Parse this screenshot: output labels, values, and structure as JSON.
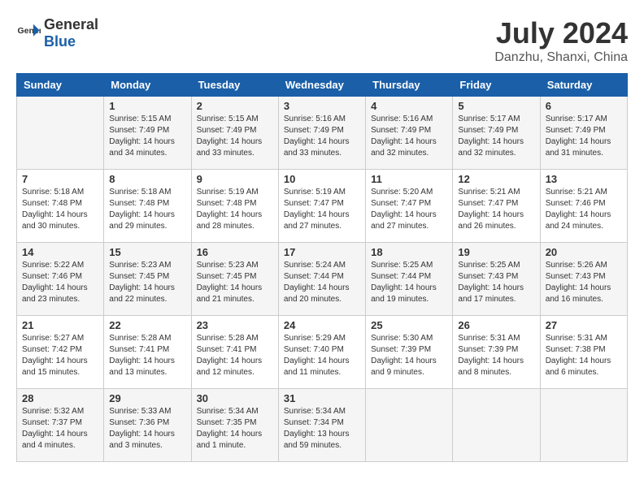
{
  "logo": {
    "general": "General",
    "blue": "Blue"
  },
  "title": {
    "month": "July 2024",
    "location": "Danzhu, Shanxi, China"
  },
  "days_of_week": [
    "Sunday",
    "Monday",
    "Tuesday",
    "Wednesday",
    "Thursday",
    "Friday",
    "Saturday"
  ],
  "weeks": [
    [
      {
        "day": "",
        "info": ""
      },
      {
        "day": "1",
        "info": "Sunrise: 5:15 AM\nSunset: 7:49 PM\nDaylight: 14 hours\nand 34 minutes."
      },
      {
        "day": "2",
        "info": "Sunrise: 5:15 AM\nSunset: 7:49 PM\nDaylight: 14 hours\nand 33 minutes."
      },
      {
        "day": "3",
        "info": "Sunrise: 5:16 AM\nSunset: 7:49 PM\nDaylight: 14 hours\nand 33 minutes."
      },
      {
        "day": "4",
        "info": "Sunrise: 5:16 AM\nSunset: 7:49 PM\nDaylight: 14 hours\nand 32 minutes."
      },
      {
        "day": "5",
        "info": "Sunrise: 5:17 AM\nSunset: 7:49 PM\nDaylight: 14 hours\nand 32 minutes."
      },
      {
        "day": "6",
        "info": "Sunrise: 5:17 AM\nSunset: 7:49 PM\nDaylight: 14 hours\nand 31 minutes."
      }
    ],
    [
      {
        "day": "7",
        "info": "Sunrise: 5:18 AM\nSunset: 7:48 PM\nDaylight: 14 hours\nand 30 minutes."
      },
      {
        "day": "8",
        "info": "Sunrise: 5:18 AM\nSunset: 7:48 PM\nDaylight: 14 hours\nand 29 minutes."
      },
      {
        "day": "9",
        "info": "Sunrise: 5:19 AM\nSunset: 7:48 PM\nDaylight: 14 hours\nand 28 minutes."
      },
      {
        "day": "10",
        "info": "Sunrise: 5:19 AM\nSunset: 7:47 PM\nDaylight: 14 hours\nand 27 minutes."
      },
      {
        "day": "11",
        "info": "Sunrise: 5:20 AM\nSunset: 7:47 PM\nDaylight: 14 hours\nand 27 minutes."
      },
      {
        "day": "12",
        "info": "Sunrise: 5:21 AM\nSunset: 7:47 PM\nDaylight: 14 hours\nand 26 minutes."
      },
      {
        "day": "13",
        "info": "Sunrise: 5:21 AM\nSunset: 7:46 PM\nDaylight: 14 hours\nand 24 minutes."
      }
    ],
    [
      {
        "day": "14",
        "info": "Sunrise: 5:22 AM\nSunset: 7:46 PM\nDaylight: 14 hours\nand 23 minutes."
      },
      {
        "day": "15",
        "info": "Sunrise: 5:23 AM\nSunset: 7:45 PM\nDaylight: 14 hours\nand 22 minutes."
      },
      {
        "day": "16",
        "info": "Sunrise: 5:23 AM\nSunset: 7:45 PM\nDaylight: 14 hours\nand 21 minutes."
      },
      {
        "day": "17",
        "info": "Sunrise: 5:24 AM\nSunset: 7:44 PM\nDaylight: 14 hours\nand 20 minutes."
      },
      {
        "day": "18",
        "info": "Sunrise: 5:25 AM\nSunset: 7:44 PM\nDaylight: 14 hours\nand 19 minutes."
      },
      {
        "day": "19",
        "info": "Sunrise: 5:25 AM\nSunset: 7:43 PM\nDaylight: 14 hours\nand 17 minutes."
      },
      {
        "day": "20",
        "info": "Sunrise: 5:26 AM\nSunset: 7:43 PM\nDaylight: 14 hours\nand 16 minutes."
      }
    ],
    [
      {
        "day": "21",
        "info": "Sunrise: 5:27 AM\nSunset: 7:42 PM\nDaylight: 14 hours\nand 15 minutes."
      },
      {
        "day": "22",
        "info": "Sunrise: 5:28 AM\nSunset: 7:41 PM\nDaylight: 14 hours\nand 13 minutes."
      },
      {
        "day": "23",
        "info": "Sunrise: 5:28 AM\nSunset: 7:41 PM\nDaylight: 14 hours\nand 12 minutes."
      },
      {
        "day": "24",
        "info": "Sunrise: 5:29 AM\nSunset: 7:40 PM\nDaylight: 14 hours\nand 11 minutes."
      },
      {
        "day": "25",
        "info": "Sunrise: 5:30 AM\nSunset: 7:39 PM\nDaylight: 14 hours\nand 9 minutes."
      },
      {
        "day": "26",
        "info": "Sunrise: 5:31 AM\nSunset: 7:39 PM\nDaylight: 14 hours\nand 8 minutes."
      },
      {
        "day": "27",
        "info": "Sunrise: 5:31 AM\nSunset: 7:38 PM\nDaylight: 14 hours\nand 6 minutes."
      }
    ],
    [
      {
        "day": "28",
        "info": "Sunrise: 5:32 AM\nSunset: 7:37 PM\nDaylight: 14 hours\nand 4 minutes."
      },
      {
        "day": "29",
        "info": "Sunrise: 5:33 AM\nSunset: 7:36 PM\nDaylight: 14 hours\nand 3 minutes."
      },
      {
        "day": "30",
        "info": "Sunrise: 5:34 AM\nSunset: 7:35 PM\nDaylight: 14 hours\nand 1 minute."
      },
      {
        "day": "31",
        "info": "Sunrise: 5:34 AM\nSunset: 7:34 PM\nDaylight: 13 hours\nand 59 minutes."
      },
      {
        "day": "",
        "info": ""
      },
      {
        "day": "",
        "info": ""
      },
      {
        "day": "",
        "info": ""
      }
    ]
  ]
}
